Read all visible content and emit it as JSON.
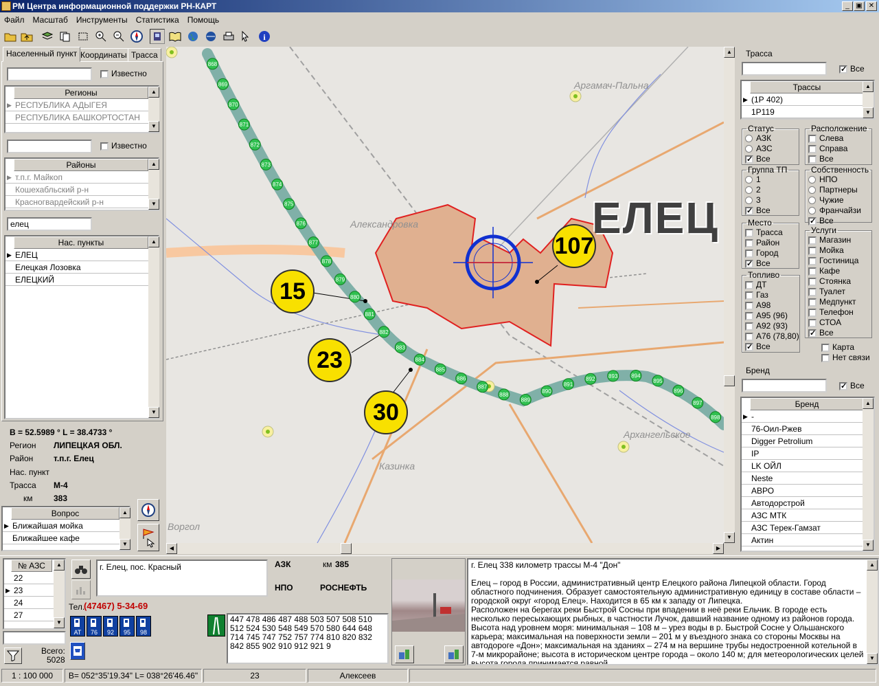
{
  "window": {
    "title": "РМ Центра информационной поддержки РН-КАРТ",
    "min": "_",
    "restore": "▣",
    "close": "✕"
  },
  "menu": [
    "Файл",
    "Масштаб",
    "Инструменты",
    "Статистика",
    "Помощь"
  ],
  "left": {
    "tabs": [
      "Населенный пункт",
      "Координаты",
      "Трасса"
    ],
    "region_search": {
      "value": "",
      "known_label": "Известно"
    },
    "regions": {
      "header": "Регионы",
      "items": [
        "РЕСПУБЛИКА АДЫГЕЯ",
        "РЕСПУБЛИКА БАШКОРТОСТАН"
      ]
    },
    "district_search": {
      "value": "",
      "known_label": "Известно"
    },
    "districts": {
      "header": "Районы",
      "items": [
        "т.п.г. Майкоп",
        "Кошехабльский р-н",
        "Красногвардейский р-н"
      ]
    },
    "settlement_search": {
      "value": "елец"
    },
    "settlements": {
      "header": "Нас. пункты",
      "items": [
        "ЕЛЕЦ",
        "Елецкая Лозовка",
        "ЕЛЕЦКИЙ"
      ]
    },
    "info": {
      "coords": "B = 52.5989 °     L = 38.4733 °",
      "region_label": "Регион",
      "region_value": "ЛИПЕЦКАЯ ОБЛ.",
      "district_label": "Район",
      "district_value": "т.п.г. Елец",
      "settlement_label": "Нас. пункт",
      "settlement_value": "",
      "route_label": "Трасса",
      "route_value": "М-4",
      "km_label": "км",
      "km_value": "383"
    },
    "question": {
      "header": "Вопрос",
      "items": [
        "Ближайшая мойка",
        "Ближайшее кафе"
      ]
    }
  },
  "map": {
    "city_label": "ЕЛЕЦ",
    "places": [
      "Аргамач-Пальна",
      "Александровка",
      "Архангельское",
      "Казинка",
      "Воргол"
    ],
    "markers": [
      {
        "label": "15"
      },
      {
        "label": "23"
      },
      {
        "label": "30"
      },
      {
        "label": "107"
      }
    ],
    "km_marks": [
      "868",
      "869",
      "870",
      "871",
      "872",
      "873",
      "874",
      "875",
      "876",
      "877",
      "878",
      "879",
      "880",
      "881",
      "882",
      "883",
      "884",
      "885",
      "886",
      "887",
      "888",
      "889",
      "890",
      "891",
      "892",
      "893",
      "894",
      "895",
      "896",
      "897",
      "898"
    ]
  },
  "right": {
    "route_title": "Трасса",
    "route_all": "Все",
    "routes": {
      "header": "Трассы",
      "items": [
        "(1Р 402)",
        "1Р119"
      ]
    },
    "status": {
      "title": "Статус",
      "items": [
        "АЗК",
        "АЗС",
        "Все"
      ]
    },
    "location": {
      "title": "Расположение",
      "items": [
        "Слева",
        "Справа",
        "Все"
      ]
    },
    "tp_group": {
      "title": "Группа ТП",
      "items": [
        "1",
        "2",
        "3",
        "Все"
      ]
    },
    "ownership": {
      "title": "Собственность",
      "items": [
        "НПО",
        "Партнеры",
        "Чужие",
        "Франчайзи",
        "Все"
      ]
    },
    "place": {
      "title": "Место",
      "items": [
        "Трасса",
        "Район",
        "Город",
        "Все"
      ]
    },
    "services": {
      "title": "Услуги",
      "items": [
        "Магазин",
        "Мойка",
        "Гостиница",
        "Кафе",
        "Стоянка",
        "Туалет",
        "Медпункт",
        "Телефон",
        "СТОА",
        "Все"
      ]
    },
    "fuel": {
      "title": "Топливо",
      "items": [
        "ДТ",
        "Газ",
        "А98",
        "А95 (96)",
        "А92 (93)",
        "А76 (78,80)",
        "Все"
      ]
    },
    "map_chk": "Карта",
    "no_link_chk": "Нет связи",
    "brand_title": "Бренд",
    "brand_all": "Все",
    "brands": {
      "header": "Бренд",
      "items": [
        "-",
        "76-Оил-Ржев",
        "Digger Petrolium",
        "IP",
        "LK ОЙЛ",
        "Neste",
        "АВРО",
        "Автодорстрой",
        "АЗС МТК",
        "АЗС Терек-Гамзат",
        "Актин"
      ]
    }
  },
  "bottom": {
    "azs_header": "№ АЗС",
    "azs_items": [
      "22",
      "23",
      "24",
      "27"
    ],
    "total_label": "Всего:",
    "total_value": "5028",
    "address": "г. Елец, пос. Красный",
    "phone_label": "Тел.",
    "phone_value": "(47467) 5-34-69",
    "type": "АЗК",
    "km_label": "км",
    "km_value": "385",
    "owner_label": "НПО",
    "owner_value": "РОСНЕФТЬ",
    "fuel_icons": [
      "АТ",
      "76",
      "92",
      "95",
      "98"
    ],
    "numbers": "447 478 486 487 488 503 507 508 510 512 524 530 548 549 570 580 644 648 714 745 747 752 757 774 810 820 832 842 855 902 910 912 921 9",
    "desc_title": "г. Елец 338 километр трассы М-4 \"Дон\"",
    "desc_text": "Елец – город в России, административный центр Елецкого района Липецкой области. Город областного подчинения. Образует самостоятельную административную единицу в составе области – городской округ «город Елец». Находится в 65 км к западу от Липецка.\nРасположен на берегах реки Быстрой Сосны при впадении в неё реки Ельчик. В городе есть несколько пересыхающих рыбных, в частности Лучок, давший название одному из районов города.\nВысота над уровнем моря: минимальная – 108 м – урез воды в р. Быстрой Сосне у Ольшанского карьера; максимальная на поверхности земли – 201 м у въездного знака со стороны Москвы на автодороге «Дон»; максимальная на зданиях – 274 м на вершине трубы недостроенной котельной в 7-м микрорайоне; высота в историческом центре города – около 140 м; для метеорологических целей высота города принимается равной"
  },
  "status": {
    "scale": "1 : 100 000",
    "coords": "B= 052°35'19.34\" L= 038°26'46.46\"",
    "number": "23",
    "user": "Алексеев"
  }
}
